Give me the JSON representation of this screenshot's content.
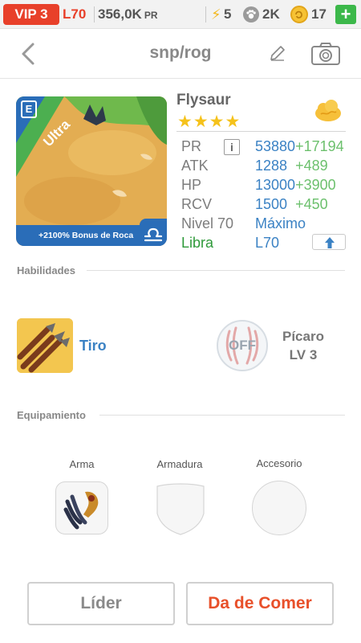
{
  "status_bar": {
    "vip": "VIP 3",
    "level": "L70",
    "power": "356,0K",
    "power_unit": "PR",
    "energy": "5",
    "pets": "2K",
    "coins": "17",
    "add_label": "+"
  },
  "header": {
    "title": "snp/rog"
  },
  "card": {
    "tier": "Ultra",
    "badge_letter": "E",
    "bonus_text": "+2100% Bonus de Roca"
  },
  "pet": {
    "name": "Flysaur",
    "stars": "★★★★",
    "stats": [
      {
        "label": "PR",
        "value": "53880",
        "bonus": "+17194"
      },
      {
        "label": "ATK",
        "value": "1288",
        "bonus": "+489"
      },
      {
        "label": "HP",
        "value": "13000",
        "bonus": "+3900"
      },
      {
        "label": "RCV",
        "value": "1500",
        "bonus": "+450"
      },
      {
        "label": "Nivel 70",
        "value": "Máximo",
        "bonus": ""
      },
      {
        "label": "Libra",
        "value": "L70",
        "bonus": ""
      }
    ],
    "info_label": "i"
  },
  "skills": {
    "section_title": "Habilidades",
    "active_name": "Tiro",
    "passive_state": "OFF",
    "passive_name": "Pícaro",
    "passive_level": "LV 3"
  },
  "equipment": {
    "section_title": "Equipamiento",
    "weapon_label": "Arma",
    "armor_label": "Armadura",
    "accessory_label": "Accesorio"
  },
  "buttons": {
    "leader": "Líder",
    "feed": "Da de Comer"
  },
  "colors": {
    "vip_red": "#e8402a",
    "link_blue": "#3b82c4",
    "bonus_green": "#6cc06d",
    "libra_green": "#2f9a3a",
    "card_blue": "#2a6db8",
    "feed_orange": "#e8502a"
  }
}
